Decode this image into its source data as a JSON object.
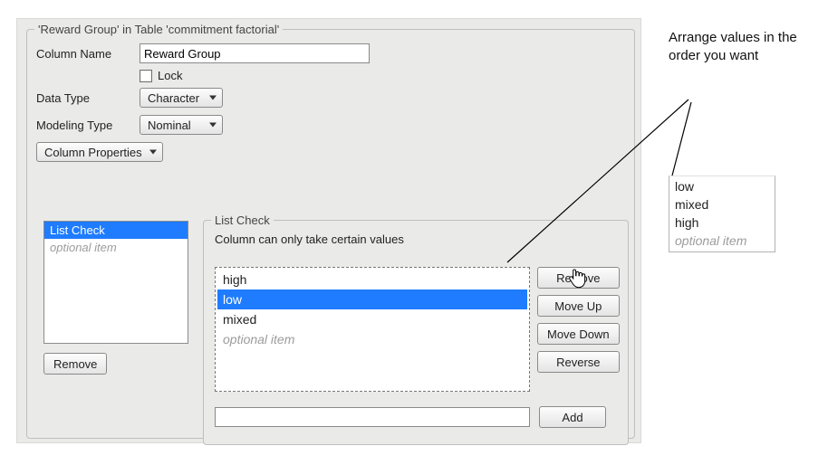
{
  "panel": {
    "legend": "'Reward Group' in Table 'commitment factorial'",
    "column_name_label": "Column Name",
    "column_name_value": "Reward Group",
    "lock_label": "Lock",
    "data_type_label": "Data Type",
    "data_type_value": "Character",
    "modeling_type_label": "Modeling Type",
    "modeling_type_value": "Nominal",
    "column_properties_label": "Column Properties"
  },
  "props_list": {
    "items": [
      "List Check",
      "optional item"
    ],
    "selected_index": 0,
    "optional_index": 1,
    "remove_label": "Remove"
  },
  "list_check": {
    "legend": "List Check",
    "caption": "Column can only take certain values",
    "values": [
      "high",
      "low",
      "mixed",
      "optional item"
    ],
    "selected_index": 1,
    "optional_index": 3,
    "buttons": {
      "remove": "Remove",
      "move_up": "Move Up",
      "move_down": "Move Down",
      "reverse": "Reverse",
      "add": "Add"
    },
    "new_value": ""
  },
  "annotation": {
    "text": "Arrange values in the order you want"
  },
  "ordered_values": {
    "items": [
      "low",
      "mixed",
      "high",
      "optional item"
    ],
    "optional_index": 3
  }
}
